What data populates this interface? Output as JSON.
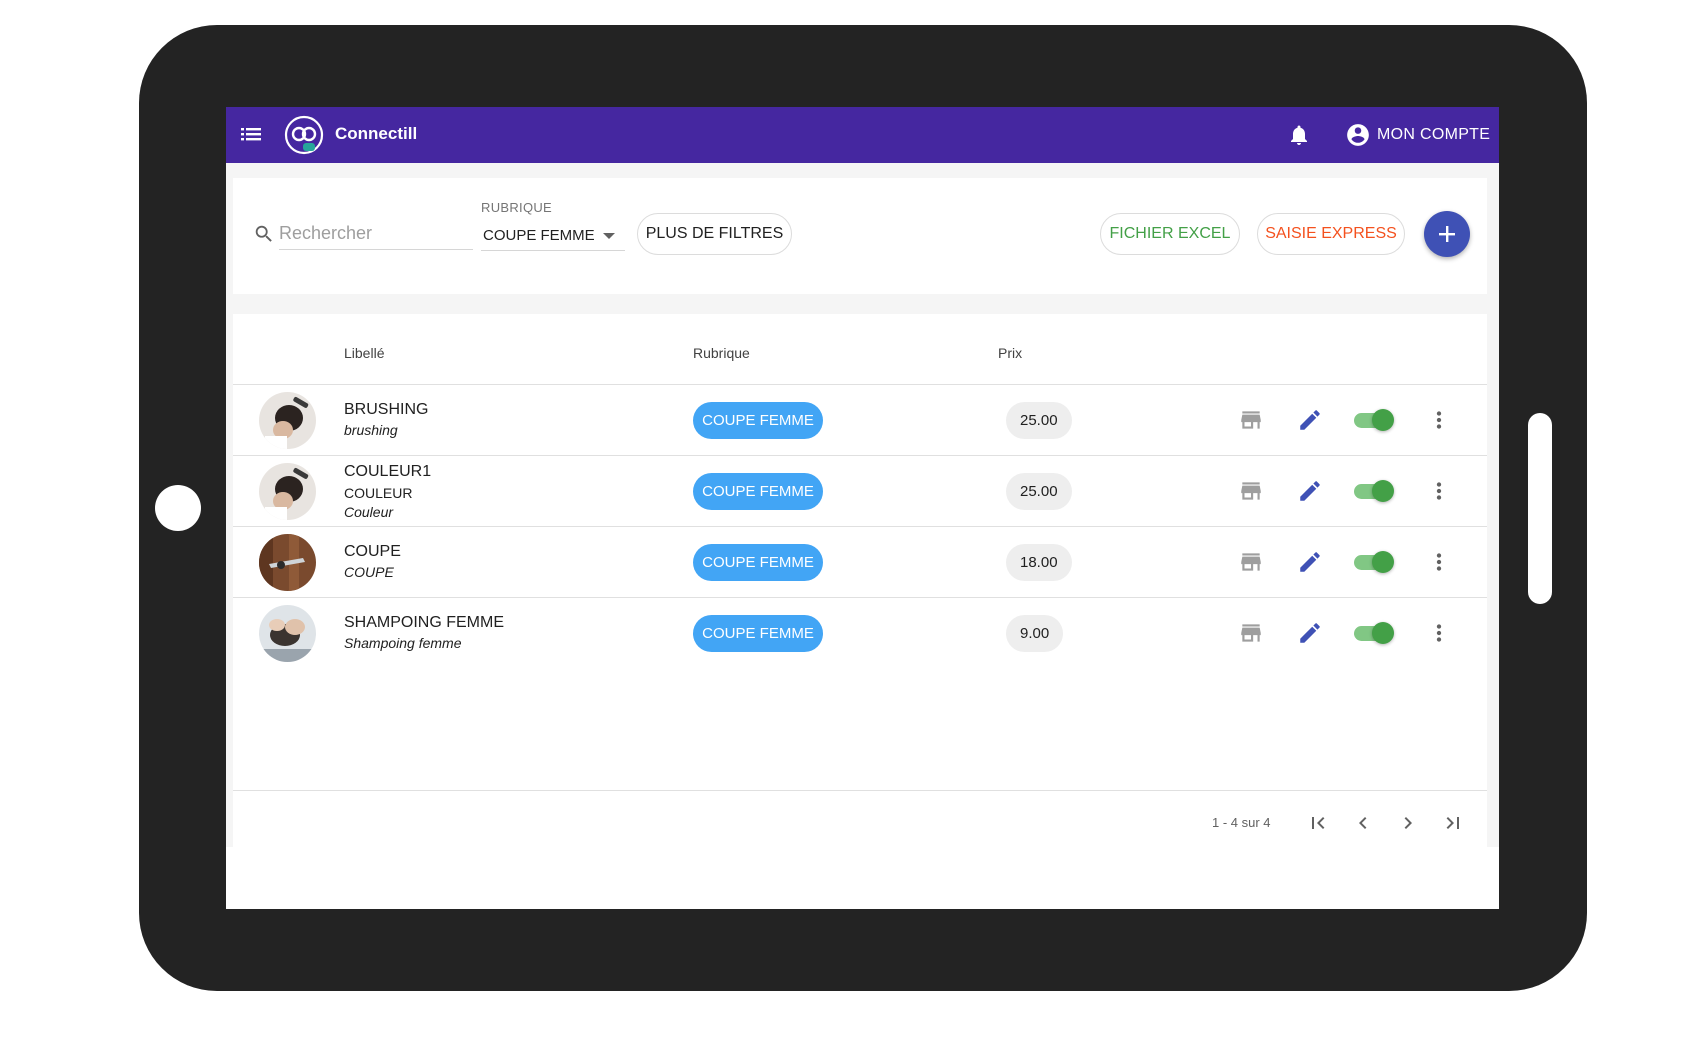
{
  "header": {
    "app_title": "Connectill",
    "account_label": "MON COMPTE",
    "brand_color": "#4527a0",
    "icons": {
      "menu": "list-menu-icon",
      "notifications": "bell-icon",
      "account": "account-circle-icon"
    }
  },
  "filters": {
    "search_placeholder": "Rechercher",
    "search_value": "",
    "rubrique_label": "RUBRIQUE",
    "rubrique_value": "COUPE FEMME",
    "more_filters_label": "PLUS DE FILTRES",
    "excel_label": "FICHIER EXCEL",
    "express_label": "SAISIE EXPRESS",
    "add_icon": "plus-icon"
  },
  "table": {
    "columns": {
      "libelle": "Libellé",
      "rubrique": "Rubrique",
      "prix": "Prix"
    },
    "rows": [
      {
        "name": "BRUSHING",
        "sub": "",
        "italic": "brushing",
        "rubrique": "COUPE FEMME",
        "price": "25.00",
        "active": true
      },
      {
        "name": "COULEUR1",
        "sub": "COULEUR",
        "italic": "Couleur",
        "rubrique": "COUPE FEMME",
        "price": "25.00",
        "active": true
      },
      {
        "name": "COUPE",
        "sub": "",
        "italic": "COUPE",
        "rubrique": "COUPE FEMME",
        "price": "18.00",
        "active": true
      },
      {
        "name": "SHAMPOING FEMME",
        "sub": "",
        "italic": "Shampoing femme",
        "rubrique": "COUPE FEMME",
        "price": "9.00",
        "active": true
      }
    ],
    "chip_color": "#42a5f5",
    "toggle_color": "#43a047"
  },
  "pagination": {
    "range_label": "1 - 4 sur 4",
    "icons": [
      "first-page-icon",
      "previous-page-icon",
      "next-page-icon",
      "last-page-icon"
    ]
  }
}
